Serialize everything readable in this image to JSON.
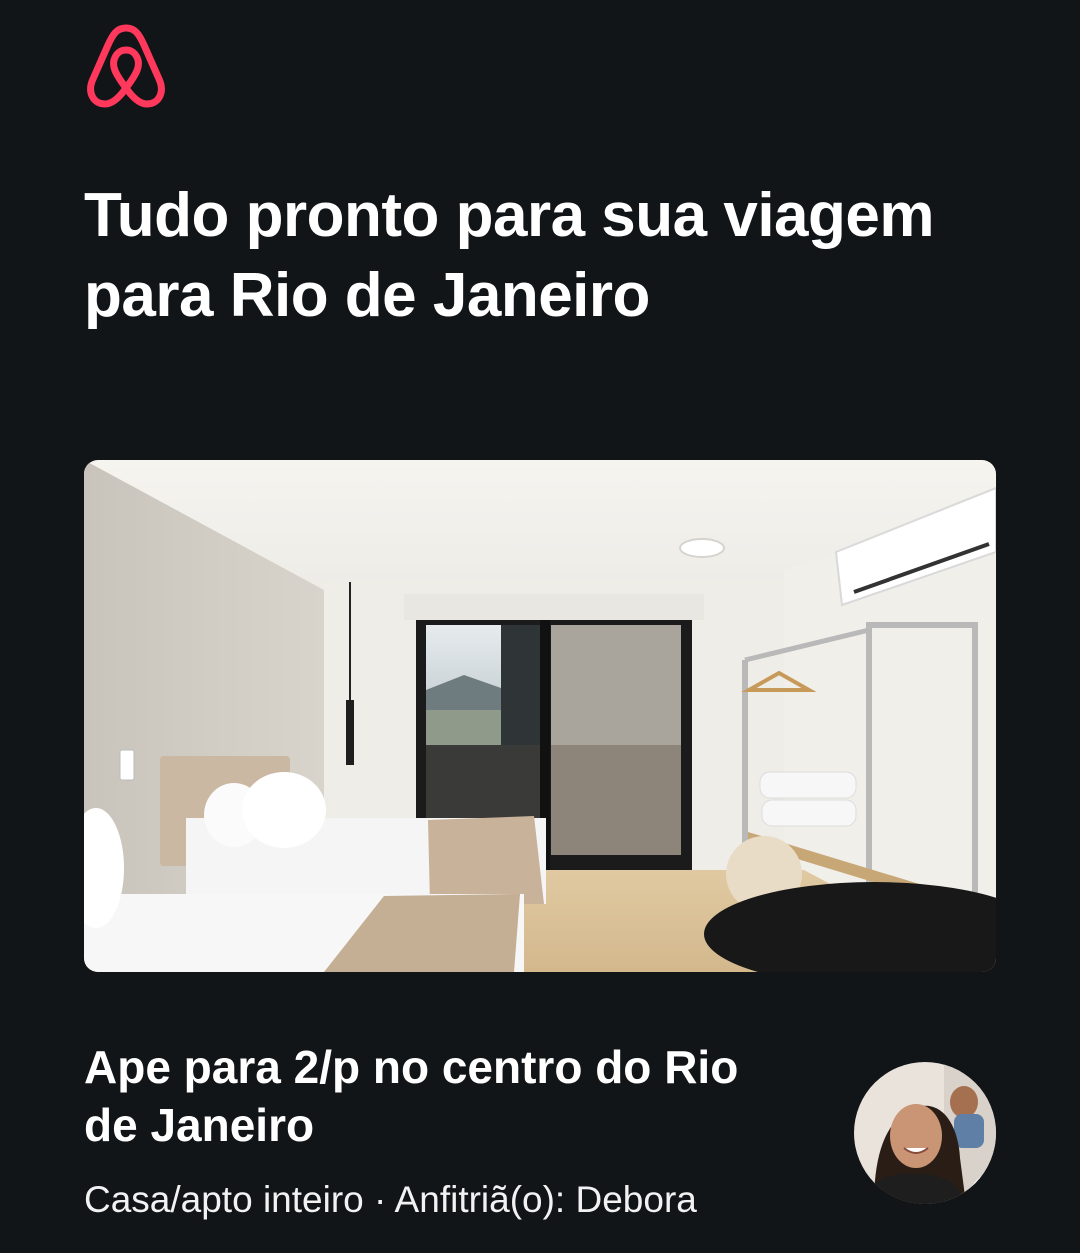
{
  "brand": {
    "logo_icon": "airbnb-belo-icon",
    "accent_color": "#FF385C"
  },
  "headline": "Tudo pronto para sua viagem para Rio de Janeiro",
  "listing": {
    "photo_icon": "listing-room-photo",
    "title": "Ape para 2/p no centro do Rio de Janeiro",
    "meta": "Casa/apto inteiro · Anfitriã(o): Debora",
    "host_avatar_icon": "host-avatar-photo"
  }
}
